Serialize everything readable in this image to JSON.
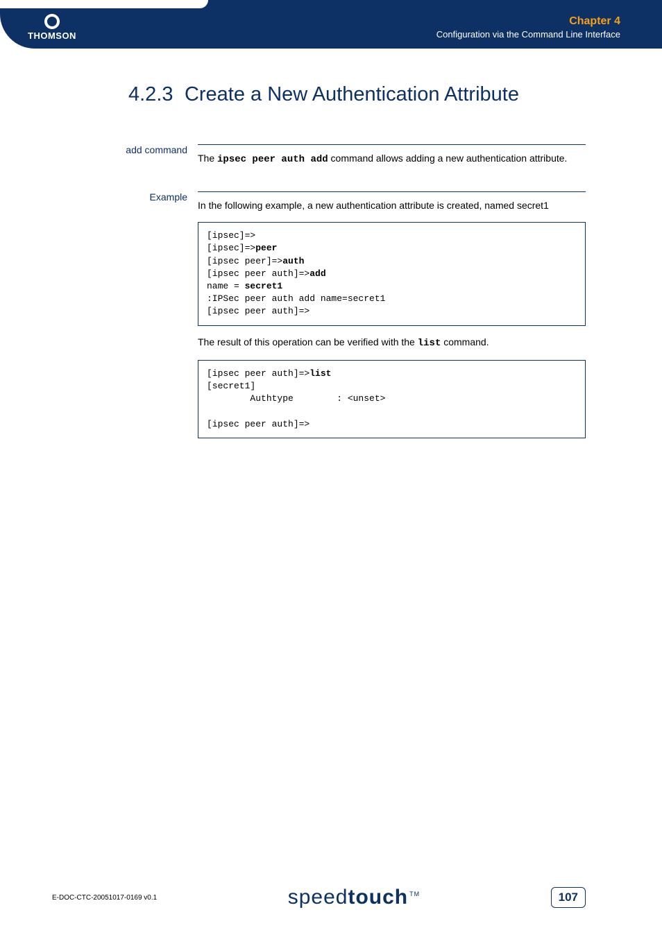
{
  "header": {
    "logo_text": "THOMSON",
    "chapter_label": "Chapter 4",
    "chapter_subtitle": "Configuration via the Command Line Interface"
  },
  "section": {
    "number": "4.2.3",
    "title": "Create a New Authentication Attribute"
  },
  "block1": {
    "label": "add command",
    "text_before": "The ",
    "command": "ipsec peer auth add",
    "text_after": " command allows adding a new authentication attribute."
  },
  "block2": {
    "label": "Example",
    "intro": "In the following example, a new authentication attribute is created, named secret1",
    "code1_l1_a": "[ipsec]=>",
    "code1_l2_a": "[ipsec]=>",
    "code1_l2_b": "peer",
    "code1_l3_a": "[ipsec peer]=>",
    "code1_l3_b": "auth",
    "code1_l4_a": "[ipsec peer auth]=>",
    "code1_l4_b": "add",
    "code1_l5_a": "name = ",
    "code1_l5_b": "secret1",
    "code1_l6": ":IPSec peer auth add name=secret1",
    "code1_l7": "[ipsec peer auth]=>",
    "mid_text_before": "The result of this operation can be verified with the ",
    "mid_command": "list",
    "mid_text_after": " command.",
    "code2_l1_a": "[ipsec peer auth]=>",
    "code2_l1_b": "list",
    "code2_l2": "[secret1]",
    "code2_l3": "        Authtype        : <unset>",
    "code2_l4": "",
    "code2_l5": "[ipsec peer auth]=>"
  },
  "footer": {
    "doc_id": "E-DOC-CTC-20051017-0169 v0.1",
    "brand_thin": "speed",
    "brand_bold": "touch",
    "brand_tm": "TM",
    "page": "107"
  }
}
